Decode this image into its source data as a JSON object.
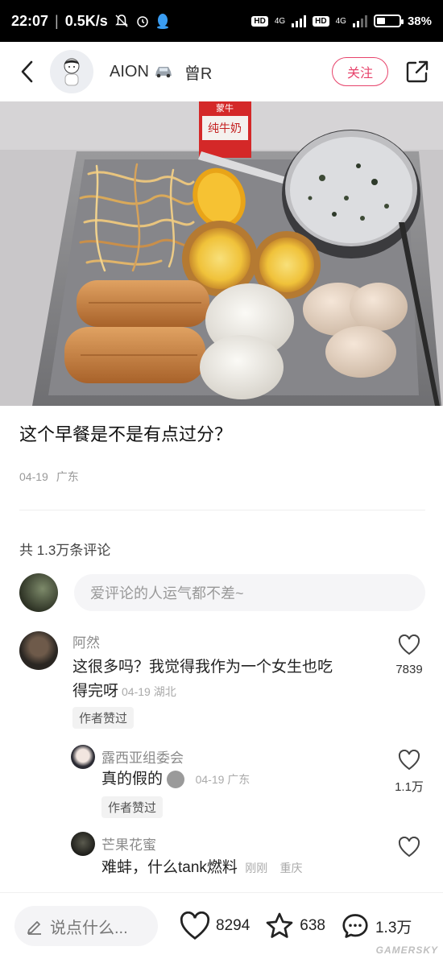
{
  "status_bar": {
    "time": "22:07",
    "speed": "0.5K/s",
    "network1": "4G",
    "network2": "4G",
    "hd": "HD",
    "battery_percent": "38%",
    "battery_level": 0.38
  },
  "header": {
    "author_name": "AION",
    "author_suffix": "曾R",
    "follow_label": "关注"
  },
  "post": {
    "title": "这个早餐是不是有点过分？",
    "date": "04-19",
    "location": "广东",
    "carton_brand": "蒙牛",
    "carton_text": "纯牛奶"
  },
  "comments_section": {
    "count_label": "共 1.3万条评论",
    "input_placeholder": "爱评论的人运气都不差~"
  },
  "comments": [
    {
      "name": "阿然",
      "text_line1": "这很多吗？我觉得我作为一个女生也吃",
      "text_line2": "得完呀",
      "time": "04-19 湖北",
      "tag": "作者赞过",
      "likes": "7839"
    },
    {
      "name": "露西亚组委会",
      "text": "真的假的",
      "time": "04-19 广东",
      "tag": "作者赞过",
      "likes": "1.1万"
    },
    {
      "name": "芒果花蜜",
      "text": "难蚌，什么tank燃料",
      "time": "刚刚",
      "location": "重庆",
      "likes": ""
    }
  ],
  "bottom_bar": {
    "say_placeholder": "说点什么...",
    "likes": "8294",
    "stars": "638",
    "comments": "1.3万",
    "watermark": "GAMERSKY"
  },
  "colors": {
    "accent": "#e7436b",
    "status_bar": "#000000"
  }
}
